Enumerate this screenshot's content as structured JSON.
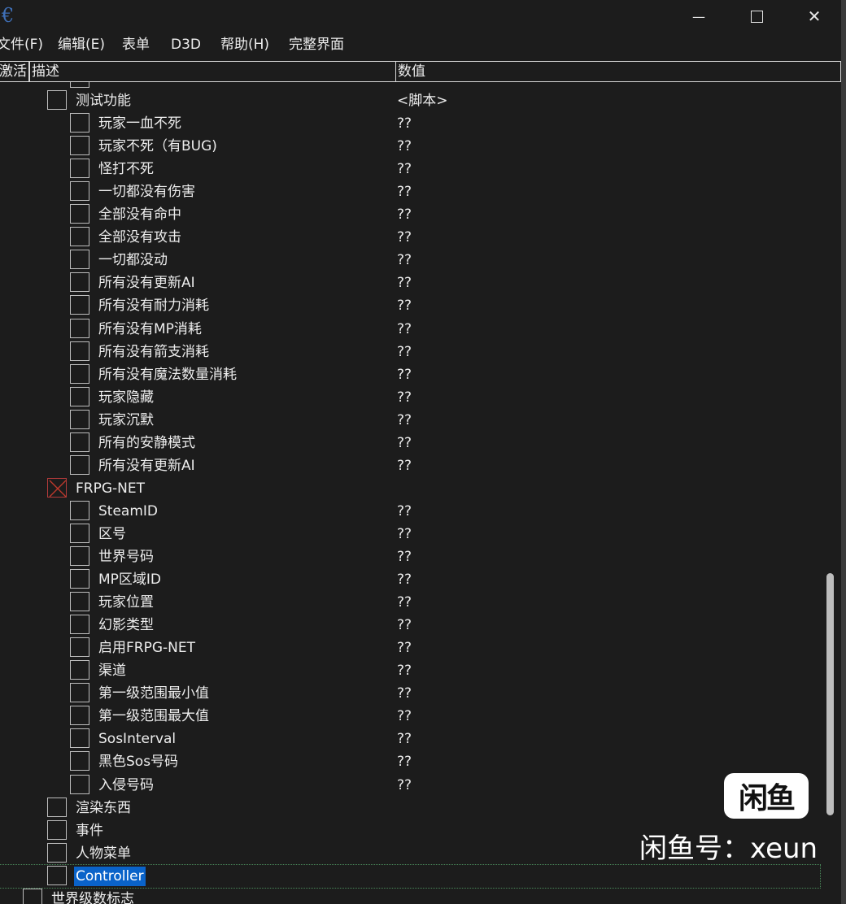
{
  "window": {
    "minimize_glyph": "—",
    "maximize_glyph": "☐",
    "close_glyph": "✕"
  },
  "menu": [
    "文件(F)",
    "编辑(E)",
    "表单",
    "D3D",
    "帮助(H)",
    "完整界面"
  ],
  "table": {
    "headers": {
      "active": "激活",
      "description": "描述",
      "value": "数值"
    },
    "rows": [
      {
        "level": 1,
        "label": "测试功能",
        "value": "<脚本>",
        "checked": false
      },
      {
        "level": 2,
        "label": "玩家一血不死",
        "value": "??",
        "checked": false
      },
      {
        "level": 2,
        "label": "玩家不死（有BUG)",
        "value": "??",
        "checked": false
      },
      {
        "level": 2,
        "label": "怪打不死",
        "value": "??",
        "checked": false
      },
      {
        "level": 2,
        "label": "一切都没有伤害",
        "value": "??",
        "checked": false
      },
      {
        "level": 2,
        "label": "全部没有命中",
        "value": "??",
        "checked": false
      },
      {
        "level": 2,
        "label": "全部没有攻击",
        "value": "??",
        "checked": false
      },
      {
        "level": 2,
        "label": "一切都没动",
        "value": "??",
        "checked": false
      },
      {
        "level": 2,
        "label": "所有没有更新AI",
        "value": "??",
        "checked": false
      },
      {
        "level": 2,
        "label": "所有没有耐力消耗",
        "value": "??",
        "checked": false
      },
      {
        "level": 2,
        "label": "所有没有MP消耗",
        "value": "??",
        "checked": false
      },
      {
        "level": 2,
        "label": "所有没有箭支消耗",
        "value": "??",
        "checked": false
      },
      {
        "level": 2,
        "label": "所有没有魔法数量消耗",
        "value": "??",
        "checked": false
      },
      {
        "level": 2,
        "label": "玩家隐藏",
        "value": "??",
        "checked": false
      },
      {
        "level": 2,
        "label": "玩家沉默",
        "value": "??",
        "checked": false
      },
      {
        "level": 2,
        "label": "所有的安静模式",
        "value": "??",
        "checked": false
      },
      {
        "level": 2,
        "label": "所有没有更新AI",
        "value": "??",
        "checked": false
      },
      {
        "level": 1,
        "label": "FRPG-NET",
        "value": "",
        "checked": true
      },
      {
        "level": 2,
        "label": "SteamID",
        "value": "??",
        "checked": false
      },
      {
        "level": 2,
        "label": "区号",
        "value": "??",
        "checked": false
      },
      {
        "level": 2,
        "label": "世界号码",
        "value": "??",
        "checked": false
      },
      {
        "level": 2,
        "label": "MP区域ID",
        "value": "??",
        "checked": false
      },
      {
        "level": 2,
        "label": "玩家位置",
        "value": "??",
        "checked": false
      },
      {
        "level": 2,
        "label": "幻影类型",
        "value": "??",
        "checked": false
      },
      {
        "level": 2,
        "label": "启用FRPG-NET",
        "value": "??",
        "checked": false
      },
      {
        "level": 2,
        "label": "渠道",
        "value": "??",
        "checked": false
      },
      {
        "level": 2,
        "label": "第一级范围最小值",
        "value": "??",
        "checked": false
      },
      {
        "level": 2,
        "label": "第一级范围最大值",
        "value": "??",
        "checked": false
      },
      {
        "level": 2,
        "label": "SosInterval",
        "value": "??",
        "checked": false
      },
      {
        "level": 2,
        "label": "黑色Sos号码",
        "value": "??",
        "checked": false
      },
      {
        "level": 2,
        "label": "入侵号码",
        "value": "??",
        "checked": false
      },
      {
        "level": 1,
        "label": "渲染东西",
        "value": "",
        "checked": false
      },
      {
        "level": 1,
        "label": "事件",
        "value": "",
        "checked": false
      },
      {
        "level": 1,
        "label": "人物菜单",
        "value": "",
        "checked": false
      },
      {
        "level": 1,
        "label": "Controller",
        "value": "",
        "checked": false,
        "selected": true
      },
      {
        "level": 0,
        "label": "世界级数标志",
        "value": "",
        "checked": false
      }
    ]
  },
  "watermark": {
    "badge": "闲鱼",
    "text": "闲鱼号：xeun"
  },
  "colors": {
    "background": "#1c1c1c",
    "selection": "#0a63c9",
    "checked_mark": "#c0392b"
  }
}
